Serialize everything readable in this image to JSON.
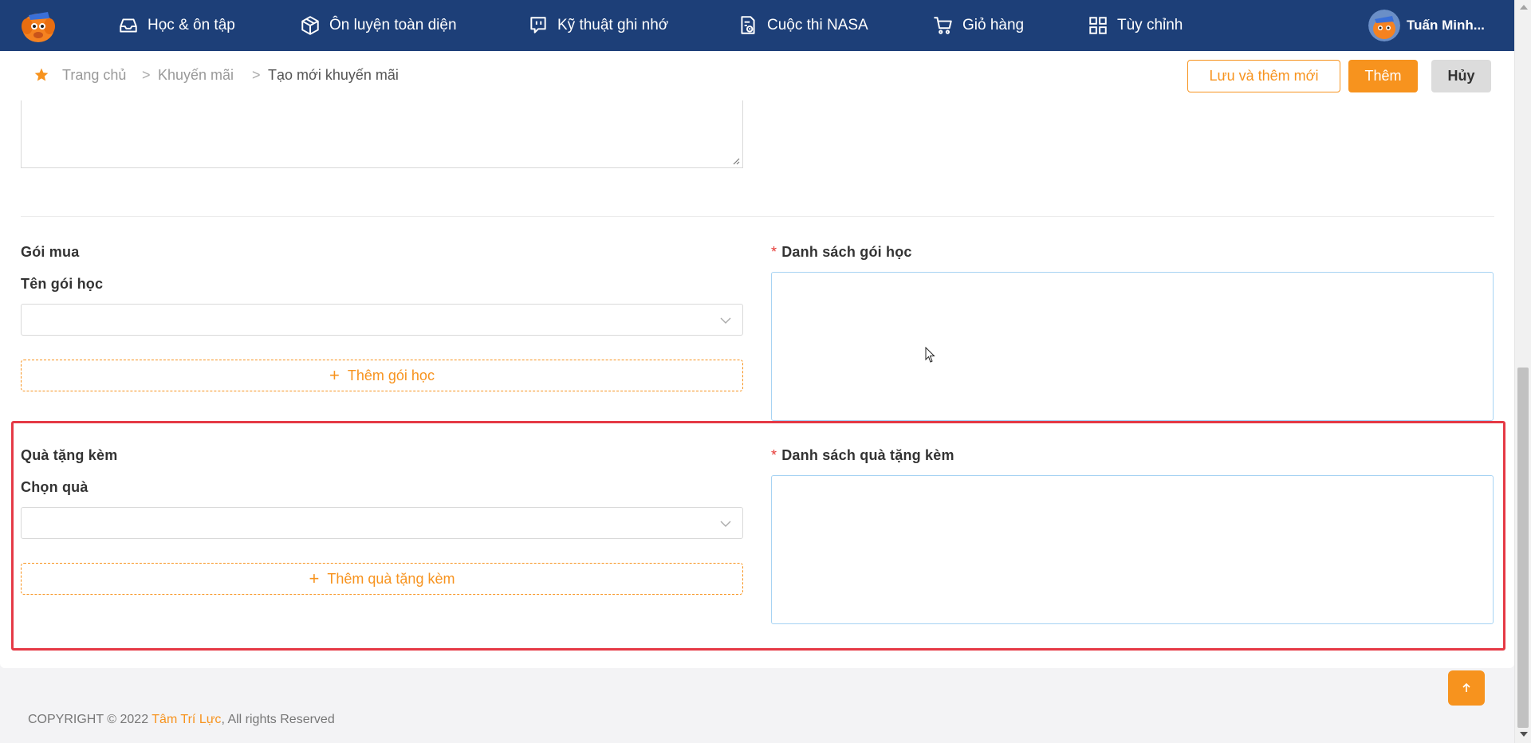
{
  "nav": {
    "items": [
      {
        "label": "Học & ôn tập",
        "icon": "inbox-icon"
      },
      {
        "label": "Ôn luyện toàn diện",
        "icon": "cube-icon"
      },
      {
        "label": "Kỹ thuật ghi nhớ",
        "icon": "chat-brain-icon"
      },
      {
        "label": "Cuộc thi NASA",
        "icon": "document-clock-icon"
      },
      {
        "label": "Giỏ hàng",
        "icon": "cart-icon"
      },
      {
        "label": "Tùy chỉnh",
        "icon": "grid-icon"
      }
    ],
    "user_name": "Tuấn Minh..."
  },
  "breadcrumb": {
    "home": "Trang chủ",
    "sep": ">",
    "section": "Khuyến mãi",
    "current": "Tạo mới khuyến mãi"
  },
  "actions": {
    "save_and_new": "Lưu và thêm mới",
    "add": "Thêm",
    "cancel": "Hủy"
  },
  "package": {
    "section_title": "Gói mua",
    "field_label": "Tên gói học",
    "select_value": "",
    "add_button": "Thêm gói học",
    "list_label": "Danh sách gói học",
    "required_mark": "*"
  },
  "gift": {
    "section_title": "Quà tặng kèm",
    "field_label": "Chọn quà",
    "select_value": "",
    "add_button": "Thêm quà tặng kèm",
    "list_label": "Danh sách quà tặng kèm",
    "required_mark": "*"
  },
  "footer": {
    "prefix": "COPYRIGHT © 2022 ",
    "brand": "Tâm Trí Lực",
    "suffix": ", All rights Reserved"
  },
  "colors": {
    "nav_bg": "#1d3f78",
    "accent": "#f7931e",
    "highlight": "#e53945",
    "required": "#e53935"
  }
}
